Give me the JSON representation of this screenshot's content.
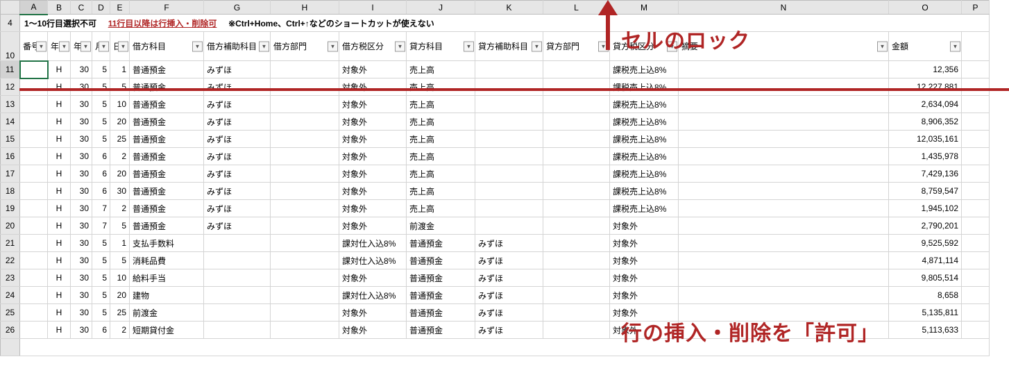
{
  "columns": [
    "A",
    "B",
    "C",
    "D",
    "E",
    "F",
    "G",
    "H",
    "I",
    "J",
    "K",
    "L",
    "M",
    "N",
    "O",
    "P"
  ],
  "visible_row_numbers": [
    "4",
    "10",
    "11",
    "12",
    "13",
    "14",
    "15",
    "16",
    "17",
    "18",
    "19",
    "20",
    "21",
    "22",
    "23",
    "24",
    "25",
    "26"
  ],
  "notice": {
    "main": "1～10行目選択不可",
    "link": "11行目以降は行挿入・削除可",
    "shortcut": "※Ctrl+Home、Ctrl+↑などのショートカットが使えない"
  },
  "headers": [
    "番号",
    "年号",
    "年",
    "月",
    "日",
    "借方科目",
    "借方補助科目",
    "借方部門",
    "借方税区分",
    "貸方科目",
    "貸方補助科目",
    "貸方部門",
    "貸方税区分",
    "摘要",
    "金額"
  ],
  "annotations": {
    "lock": "セルのロック",
    "allow": "行の挿入・削除を「許可」"
  },
  "rows": [
    {
      "b": "H",
      "c": "30",
      "d": "5",
      "e": "1",
      "f": "普通預金",
      "g": "みずほ",
      "i": "対象外",
      "j": "売上高",
      "k": "",
      "m": "課税売上込8%",
      "o": "12,356"
    },
    {
      "b": "H",
      "c": "30",
      "d": "5",
      "e": "5",
      "f": "普通預金",
      "g": "みずほ",
      "i": "対象外",
      "j": "売上高",
      "k": "",
      "m": "課税売上込8%",
      "o": "12,227,881"
    },
    {
      "b": "H",
      "c": "30",
      "d": "5",
      "e": "10",
      "f": "普通預金",
      "g": "みずほ",
      "i": "対象外",
      "j": "売上高",
      "k": "",
      "m": "課税売上込8%",
      "o": "2,634,094"
    },
    {
      "b": "H",
      "c": "30",
      "d": "5",
      "e": "20",
      "f": "普通預金",
      "g": "みずほ",
      "i": "対象外",
      "j": "売上高",
      "k": "",
      "m": "課税売上込8%",
      "o": "8,906,352"
    },
    {
      "b": "H",
      "c": "30",
      "d": "5",
      "e": "25",
      "f": "普通預金",
      "g": "みずほ",
      "i": "対象外",
      "j": "売上高",
      "k": "",
      "m": "課税売上込8%",
      "o": "12,035,161"
    },
    {
      "b": "H",
      "c": "30",
      "d": "6",
      "e": "2",
      "f": "普通預金",
      "g": "みずほ",
      "i": "対象外",
      "j": "売上高",
      "k": "",
      "m": "課税売上込8%",
      "o": "1,435,978"
    },
    {
      "b": "H",
      "c": "30",
      "d": "6",
      "e": "20",
      "f": "普通預金",
      "g": "みずほ",
      "i": "対象外",
      "j": "売上高",
      "k": "",
      "m": "課税売上込8%",
      "o": "7,429,136"
    },
    {
      "b": "H",
      "c": "30",
      "d": "6",
      "e": "30",
      "f": "普通預金",
      "g": "みずほ",
      "i": "対象外",
      "j": "売上高",
      "k": "",
      "m": "課税売上込8%",
      "o": "8,759,547"
    },
    {
      "b": "H",
      "c": "30",
      "d": "7",
      "e": "2",
      "f": "普通預金",
      "g": "みずほ",
      "i": "対象外",
      "j": "売上高",
      "k": "",
      "m": "課税売上込8%",
      "o": "1,945,102"
    },
    {
      "b": "H",
      "c": "30",
      "d": "7",
      "e": "5",
      "f": "普通預金",
      "g": "みずほ",
      "i": "対象外",
      "j": "前渡金",
      "k": "",
      "m": "対象外",
      "o": "2,790,201"
    },
    {
      "b": "H",
      "c": "30",
      "d": "5",
      "e": "1",
      "f": "支払手数料",
      "g": "",
      "i": "課対仕入込8%",
      "j": "普通預金",
      "k": "みずほ",
      "m": "対象外",
      "o": "9,525,592"
    },
    {
      "b": "H",
      "c": "30",
      "d": "5",
      "e": "5",
      "f": "消耗品費",
      "g": "",
      "i": "課対仕入込8%",
      "j": "普通預金",
      "k": "みずほ",
      "m": "対象外",
      "o": "4,871,114"
    },
    {
      "b": "H",
      "c": "30",
      "d": "5",
      "e": "10",
      "f": "給料手当",
      "g": "",
      "i": "対象外",
      "j": "普通預金",
      "k": "みずほ",
      "m": "対象外",
      "o": "9,805,514"
    },
    {
      "b": "H",
      "c": "30",
      "d": "5",
      "e": "20",
      "f": "建物",
      "g": "",
      "i": "課対仕入込8%",
      "j": "普通預金",
      "k": "みずほ",
      "m": "対象外",
      "o": "8,658"
    },
    {
      "b": "H",
      "c": "30",
      "d": "5",
      "e": "25",
      "f": "前渡金",
      "g": "",
      "i": "対象外",
      "j": "普通預金",
      "k": "みずほ",
      "m": "対象外",
      "o": "5,135,811"
    },
    {
      "b": "H",
      "c": "30",
      "d": "6",
      "e": "2",
      "f": "短期貸付金",
      "g": "",
      "i": "対象外",
      "j": "普通預金",
      "k": "みずほ",
      "m": "対象外",
      "o": "5,113,633"
    }
  ]
}
